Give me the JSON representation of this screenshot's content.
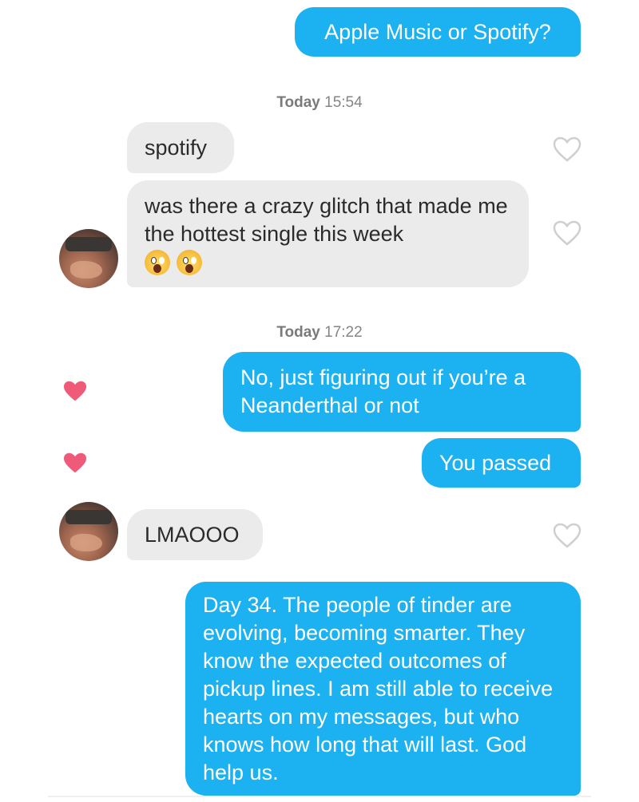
{
  "messages": [
    {
      "id": "m1",
      "text": "Apple Music or Spotify?"
    },
    {
      "id": "m2",
      "text": "spotify"
    },
    {
      "id": "m3",
      "text": "was there a crazy glitch that made me the hottest single this week"
    },
    {
      "id": "m4",
      "text": "No, just figuring out if you’re a Neanderthal or not"
    },
    {
      "id": "m5",
      "text": "You passed"
    },
    {
      "id": "m6",
      "text": "LMAOOO"
    },
    {
      "id": "m7",
      "text": "Day 34. The people of tinder are evolving, becoming smarter. They know the expected outcomes of pickup lines. I am still able to receive hearts on my messages, but who knows how long that will last. God help us."
    }
  ],
  "timestamps": [
    {
      "day": "Today",
      "time": "15:54"
    },
    {
      "day": "Today",
      "time": "17:22"
    }
  ],
  "emojis": [
    "face-screaming-in-fear",
    "face-screaming-in-fear"
  ],
  "colors": {
    "outgoing_bubble": "#1cb1f0",
    "incoming_bubble": "#ebebeb",
    "liked_heart": "#ee5a78",
    "unliked_heart": "#cfcfcf",
    "timestamp_text": "#858585"
  },
  "icons": {
    "like_filled": "heart-filled-icon",
    "like_outline": "heart-outline-icon"
  }
}
